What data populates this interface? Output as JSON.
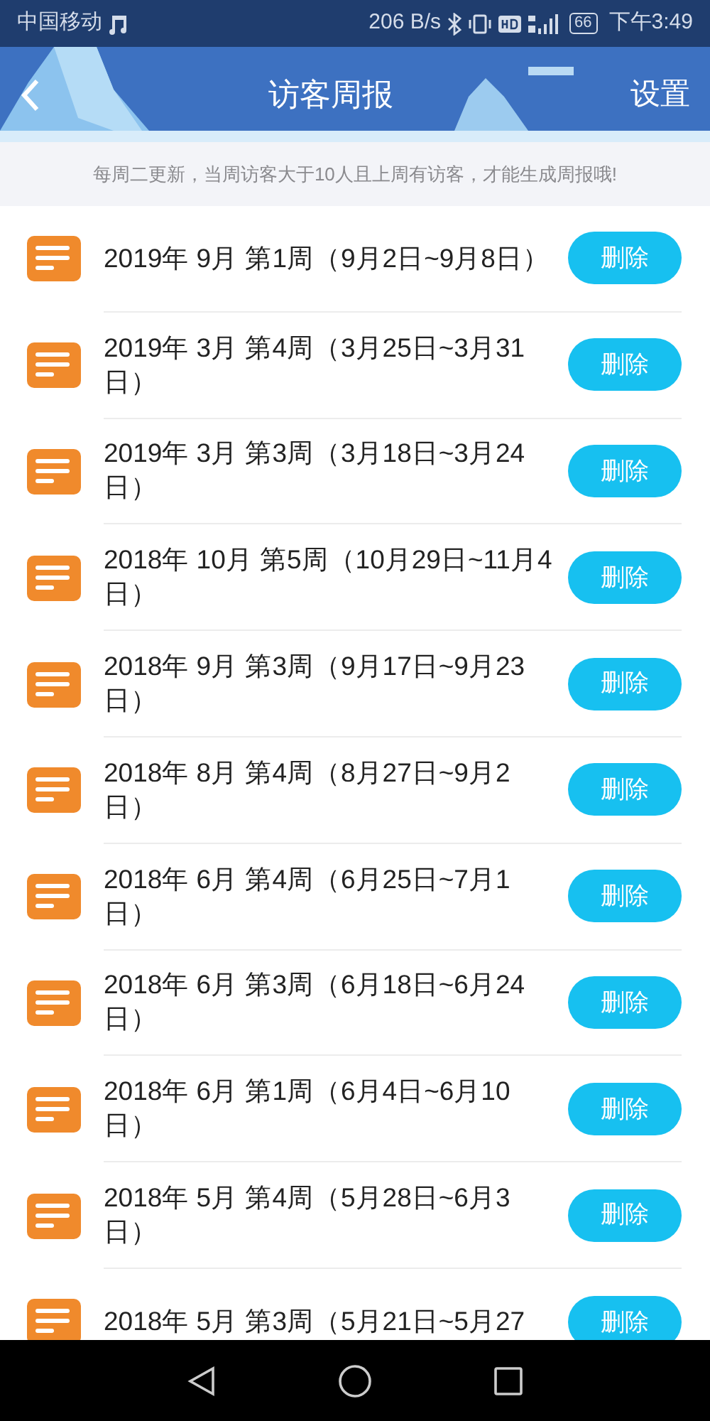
{
  "status_bar": {
    "carrier": "中国移动",
    "speed": "206 B/s",
    "battery": "66",
    "time": "下午3:49"
  },
  "header": {
    "title": "访客周报",
    "action": "设置"
  },
  "notice": "每周二更新，当周访客大于10人且上周有访客，才能生成周报哦!",
  "reports": [
    {
      "title": "2019年 9月 第1周（9月2日~9月8日）",
      "button": "删除"
    },
    {
      "title": "2019年 3月 第4周（3月25日~3月31日）",
      "button": "删除"
    },
    {
      "title": "2019年 3月 第3周（3月18日~3月24日）",
      "button": "删除"
    },
    {
      "title": "2018年 10月 第5周（10月29日~11月4日）",
      "button": "删除"
    },
    {
      "title": "2018年 9月 第3周（9月17日~9月23日）",
      "button": "删除"
    },
    {
      "title": "2018年 8月 第4周（8月27日~9月2日）",
      "button": "删除"
    },
    {
      "title": "2018年 6月 第4周（6月25日~7月1日）",
      "button": "删除"
    },
    {
      "title": "2018年 6月 第3周（6月18日~6月24日）",
      "button": "删除"
    },
    {
      "title": "2018年 6月 第1周（6月4日~6月10日）",
      "button": "删除"
    },
    {
      "title": "2018年 5月 第4周（5月28日~6月3日）",
      "button": "删除"
    },
    {
      "title": "2018年 5月 第3周（5月21日~5月27",
      "button": "删除"
    }
  ]
}
